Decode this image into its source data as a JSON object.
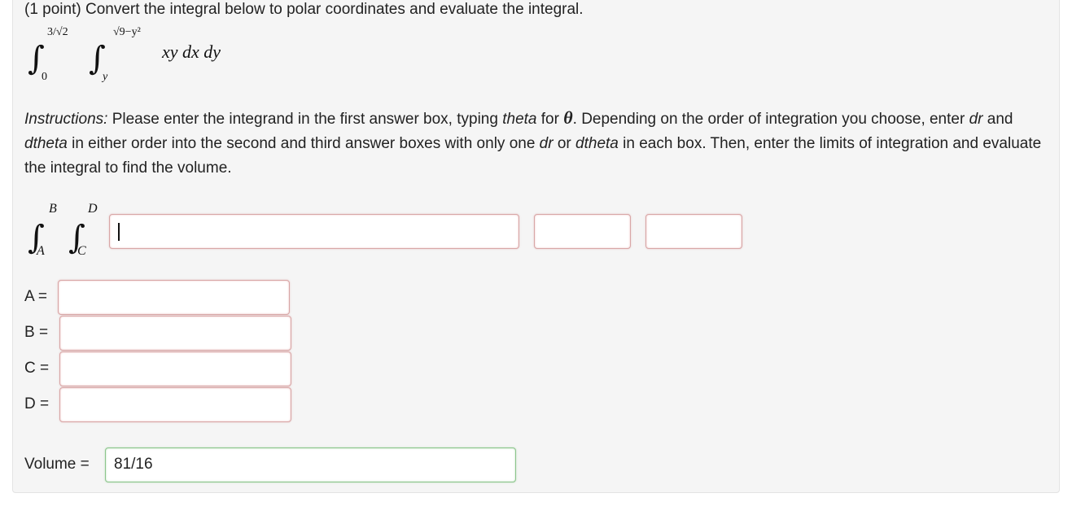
{
  "problem": {
    "title": "(1 point) Convert the integral below to polar coordinates and evaluate the integral.",
    "outer_upper": "3/√2",
    "outer_lower": "0",
    "inner_upper": "√9−y²",
    "inner_lower": "y",
    "integrand": "xy dx dy"
  },
  "instructions": {
    "lead": "Instructions:",
    "t1": " Please enter the integrand in the first answer box, typing ",
    "theta_word": "theta",
    "t2": " for ",
    "theta_symbol": "θ",
    "t3": ". Depending on the order of integration you choose, enter ",
    "dr1": "dr",
    "t4": " and ",
    "dtheta1": "dtheta",
    "t5": " in either order into the second and third answer boxes with only one ",
    "dr2": "dr",
    "t6": " or ",
    "dtheta2": "dtheta",
    "t7": " in each box. Then, enter the limits of integration and evaluate the integral to find the volume."
  },
  "answer_integral": {
    "outer_upper": "B",
    "outer_lower": "A",
    "inner_upper": "D",
    "inner_lower": "C"
  },
  "answers": {
    "integrand_value": "",
    "differential_1_value": "",
    "differential_2_value": "",
    "a_label": "A =",
    "a_value": "",
    "b_label": "B =",
    "b_value": "",
    "c_label": "C =",
    "c_value": "",
    "d_label": "D =",
    "d_value": "",
    "volume_label": "Volume =",
    "volume_value": "81/16"
  },
  "colors": {
    "incorrect_border": "#d8a6a6",
    "correct_border": "#8cc58c",
    "panel_background": "#f5f5f5"
  }
}
